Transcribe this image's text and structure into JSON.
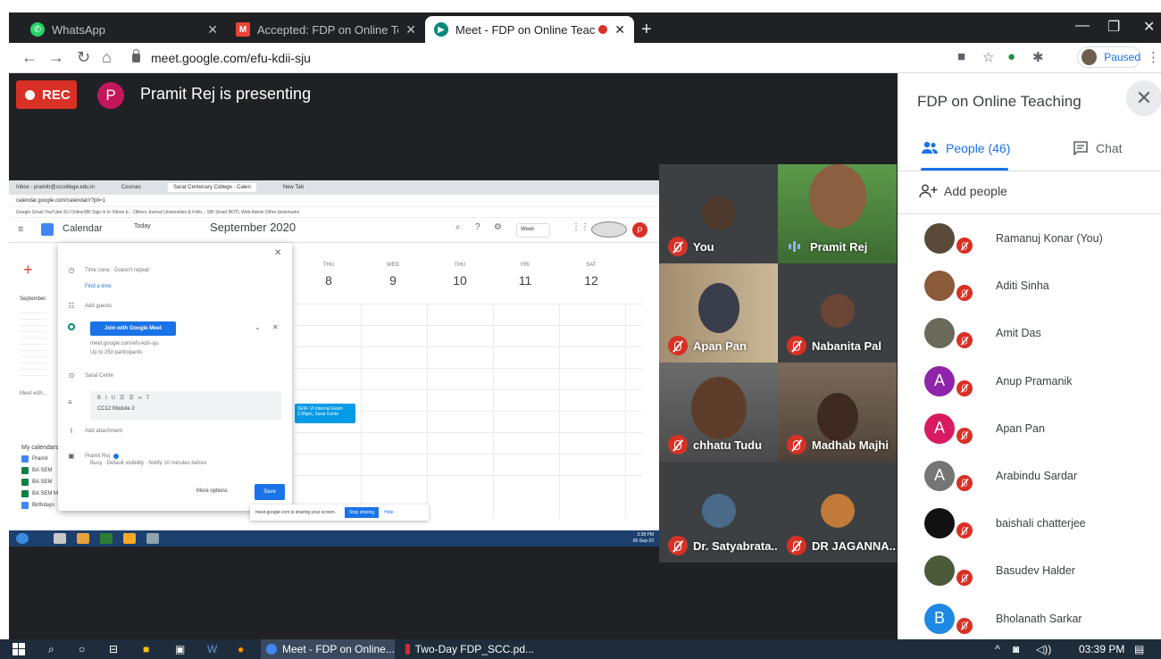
{
  "browser": {
    "tabs": [
      {
        "label": "WhatsApp",
        "icon": "whatsapp-icon",
        "color": "#25d366"
      },
      {
        "label": "Accepted: FDP on Online Teachin",
        "icon": "gmail-icon",
        "color": "#ea4335"
      },
      {
        "label": "Meet - FDP on Online Teachi",
        "icon": "meet-icon",
        "color": "#00897b"
      }
    ],
    "url": "meet.google.com/efu-kdii-sju",
    "profile_status": "Paused"
  },
  "meet": {
    "rec_label": "REC",
    "presenter_initial": "P",
    "presenting_text": "Pramit Rej is presenting",
    "shared_screen": {
      "tabs": [
        "Inbox - pramitr@sccollege.edu.in",
        "Courses",
        "Sarat Centenary College - Calen",
        "New Tab"
      ],
      "address": "calendar.google.com/calendar/r?pli=1",
      "bookmarks": "Google  Gmail  YouTube  SU  OnlineSBI  Sign in to Yahoo b...  Others  Journal  Universities & Fello...  SBI Smart  BOTL Web Admin   Other bookmarks",
      "calendar_label": "Calendar",
      "today_label": "Today",
      "month_label": "September 2020",
      "view_label": "Week",
      "avatar_initial": "P",
      "days": [
        {
          "name": "THU",
          "date": "8"
        },
        {
          "name": "WED",
          "date": "9"
        },
        {
          "name": "THU",
          "date": "10"
        },
        {
          "name": "FRI",
          "date": "11"
        },
        {
          "name": "SAT",
          "date": "12"
        }
      ],
      "event_text": "SEM- VI Internal Exam 2:30pm, Sarat Cente",
      "sidebar_month": "September",
      "meet_with": "Meet with...",
      "my_calendars": "My calendars",
      "calendars": [
        "Pramit",
        "BA SEM",
        "BA SEM",
        "BA SEM MATHEMATICS",
        "Birthdays"
      ],
      "dialog": {
        "timezone": "Time zone · Doesn't repeat",
        "find_time": "Find a time",
        "add_guests": "Add guests",
        "join_button": "Join with Google Meet",
        "meet_link": "meet.google.com/efu-kdii-sju",
        "participants": "Up to 250 participants",
        "location": "Sarat Cente",
        "description": "CC12 Module 2",
        "attachment": "Add attachment",
        "owner": "Pramit Rej",
        "visibility": "Busy · Default visibility · Notify 10 minutes before",
        "more_options": "More options",
        "save": "Save"
      },
      "sharing_text": "meet.google.com is sharing your screen.",
      "stop_sharing": "Stop sharing",
      "hide": "Hide",
      "clock_time": "3:38 PM",
      "clock_date": "06-Sep-20"
    },
    "tiles": [
      {
        "name": "You",
        "muted": true
      },
      {
        "name": "Pramit Rej",
        "muted": false
      },
      {
        "name": "Apan Pan",
        "muted": true
      },
      {
        "name": "Nabanita Pal",
        "muted": true
      },
      {
        "name": "chhatu Tudu",
        "muted": true
      },
      {
        "name": "Madhab Majhi",
        "muted": true
      },
      {
        "name": "Dr. Satyabrata...",
        "muted": true
      },
      {
        "name": "DR JAGANNA...",
        "muted": true
      }
    ]
  },
  "panel": {
    "title": "FDP on Online Teaching",
    "people_tab": "People (46)",
    "chat_tab": "Chat",
    "add_people": "Add people",
    "participants": [
      {
        "name": "Ramanuj Konar (You)",
        "initial": "",
        "color": "#5a4a3a"
      },
      {
        "name": "Aditi Sinha",
        "initial": "",
        "color": "#8a5a3a"
      },
      {
        "name": "Amit Das",
        "initial": "",
        "color": "#6a6a5a"
      },
      {
        "name": "Anup Pramanik",
        "initial": "A",
        "color": "#8e24aa"
      },
      {
        "name": "Apan Pan",
        "initial": "A",
        "color": "#d81b60"
      },
      {
        "name": "Arabindu Sardar",
        "initial": "A",
        "color": "#757575"
      },
      {
        "name": "baishali chatterjee",
        "initial": "",
        "color": "#111111"
      },
      {
        "name": "Basudev Halder",
        "initial": "",
        "color": "#4a5a3a"
      },
      {
        "name": "Bholanath Sarkar",
        "initial": "B",
        "color": "#1e88e5"
      }
    ]
  },
  "taskbar": {
    "tasks": [
      "Meet - FDP on Online...",
      "Two-Day FDP_SCC.pd..."
    ],
    "time": "03:39 PM"
  }
}
